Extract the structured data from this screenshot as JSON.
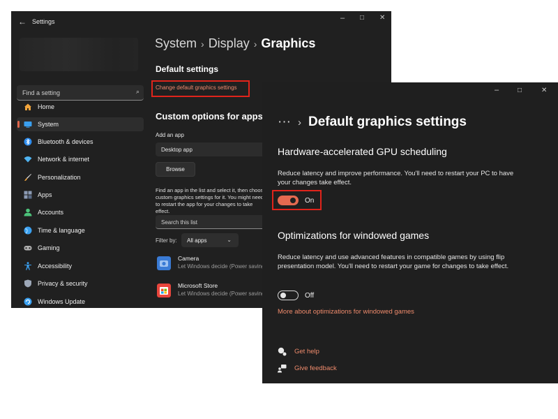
{
  "settings_window": {
    "title": "Settings",
    "controls": {
      "minimize": "–",
      "maximize": "□",
      "close": "✕"
    },
    "search": {
      "placeholder": "Find a setting"
    },
    "nav": [
      {
        "label": "Home",
        "icon": "home-icon",
        "color": "#f0a43c"
      },
      {
        "label": "System",
        "icon": "system-icon",
        "color": "#3aa0f0",
        "active": true
      },
      {
        "label": "Bluetooth & devices",
        "icon": "bluetooth-icon",
        "color": "#2f8ef0"
      },
      {
        "label": "Network & internet",
        "icon": "network-icon",
        "color": "#4fb3f0"
      },
      {
        "label": "Personalization",
        "icon": "brush-icon",
        "color": "#f0a43c"
      },
      {
        "label": "Apps",
        "icon": "apps-icon",
        "color": "#8c9bb5"
      },
      {
        "label": "Accounts",
        "icon": "accounts-icon",
        "color": "#4cc27a"
      },
      {
        "label": "Time & language",
        "icon": "globe-icon",
        "color": "#3aa0f0"
      },
      {
        "label": "Gaming",
        "icon": "gaming-icon",
        "color": "#b0b0b0"
      },
      {
        "label": "Accessibility",
        "icon": "accessibility-icon",
        "color": "#3aa0f0"
      },
      {
        "label": "Privacy & security",
        "icon": "shield-icon",
        "color": "#9da8b8"
      },
      {
        "label": "Windows Update",
        "icon": "update-icon",
        "color": "#3aa0f0"
      }
    ],
    "breadcrumb": [
      "System",
      "Display",
      "Graphics"
    ],
    "default_settings_heading": "Default settings",
    "change_link": "Change default graphics settings",
    "custom_heading": "Custom options for apps",
    "add_app_label": "Add an app",
    "add_app_value": "Desktop app",
    "browse_label": "Browse",
    "info_text": "Find an app in the list and select it, then choose custom graphics settings for it. You might need to restart the app for your changes to take effect.",
    "list_search_placeholder": "Search this list",
    "filter_label": "Filter by:",
    "filter_value": "All apps",
    "apps": [
      {
        "name": "Camera",
        "desc": "Let Windows decide (Power saving)",
        "icon": "camera-icon",
        "color": "#3a7bd5"
      },
      {
        "name": "Microsoft Store",
        "desc": "Let Windows decide (Power saving)",
        "icon": "store-icon",
        "color": "#e8453c"
      }
    ]
  },
  "graphics_window": {
    "controls": {
      "minimize": "–",
      "maximize": "□",
      "close": "✕"
    },
    "breadcrumb_more": "···",
    "breadcrumb_sep": "›",
    "title": "Default graphics settings",
    "gpu_heading": "Hardware-accelerated GPU scheduling",
    "gpu_desc": "Reduce latency and improve performance. You'll need to restart your PC to have your changes take effect.",
    "gpu_toggle": "On",
    "windowed_heading": "Optimizations for windowed games",
    "windowed_desc": "Reduce latency and use advanced features in compatible games by using flip presentation model. You'll need to restart your game for changes to take effect.",
    "windowed_toggle": "Off",
    "more_link": "More about optimizations for windowed games",
    "get_help": "Get help",
    "give_feedback": "Give feedback",
    "accent": "#e56a50"
  }
}
